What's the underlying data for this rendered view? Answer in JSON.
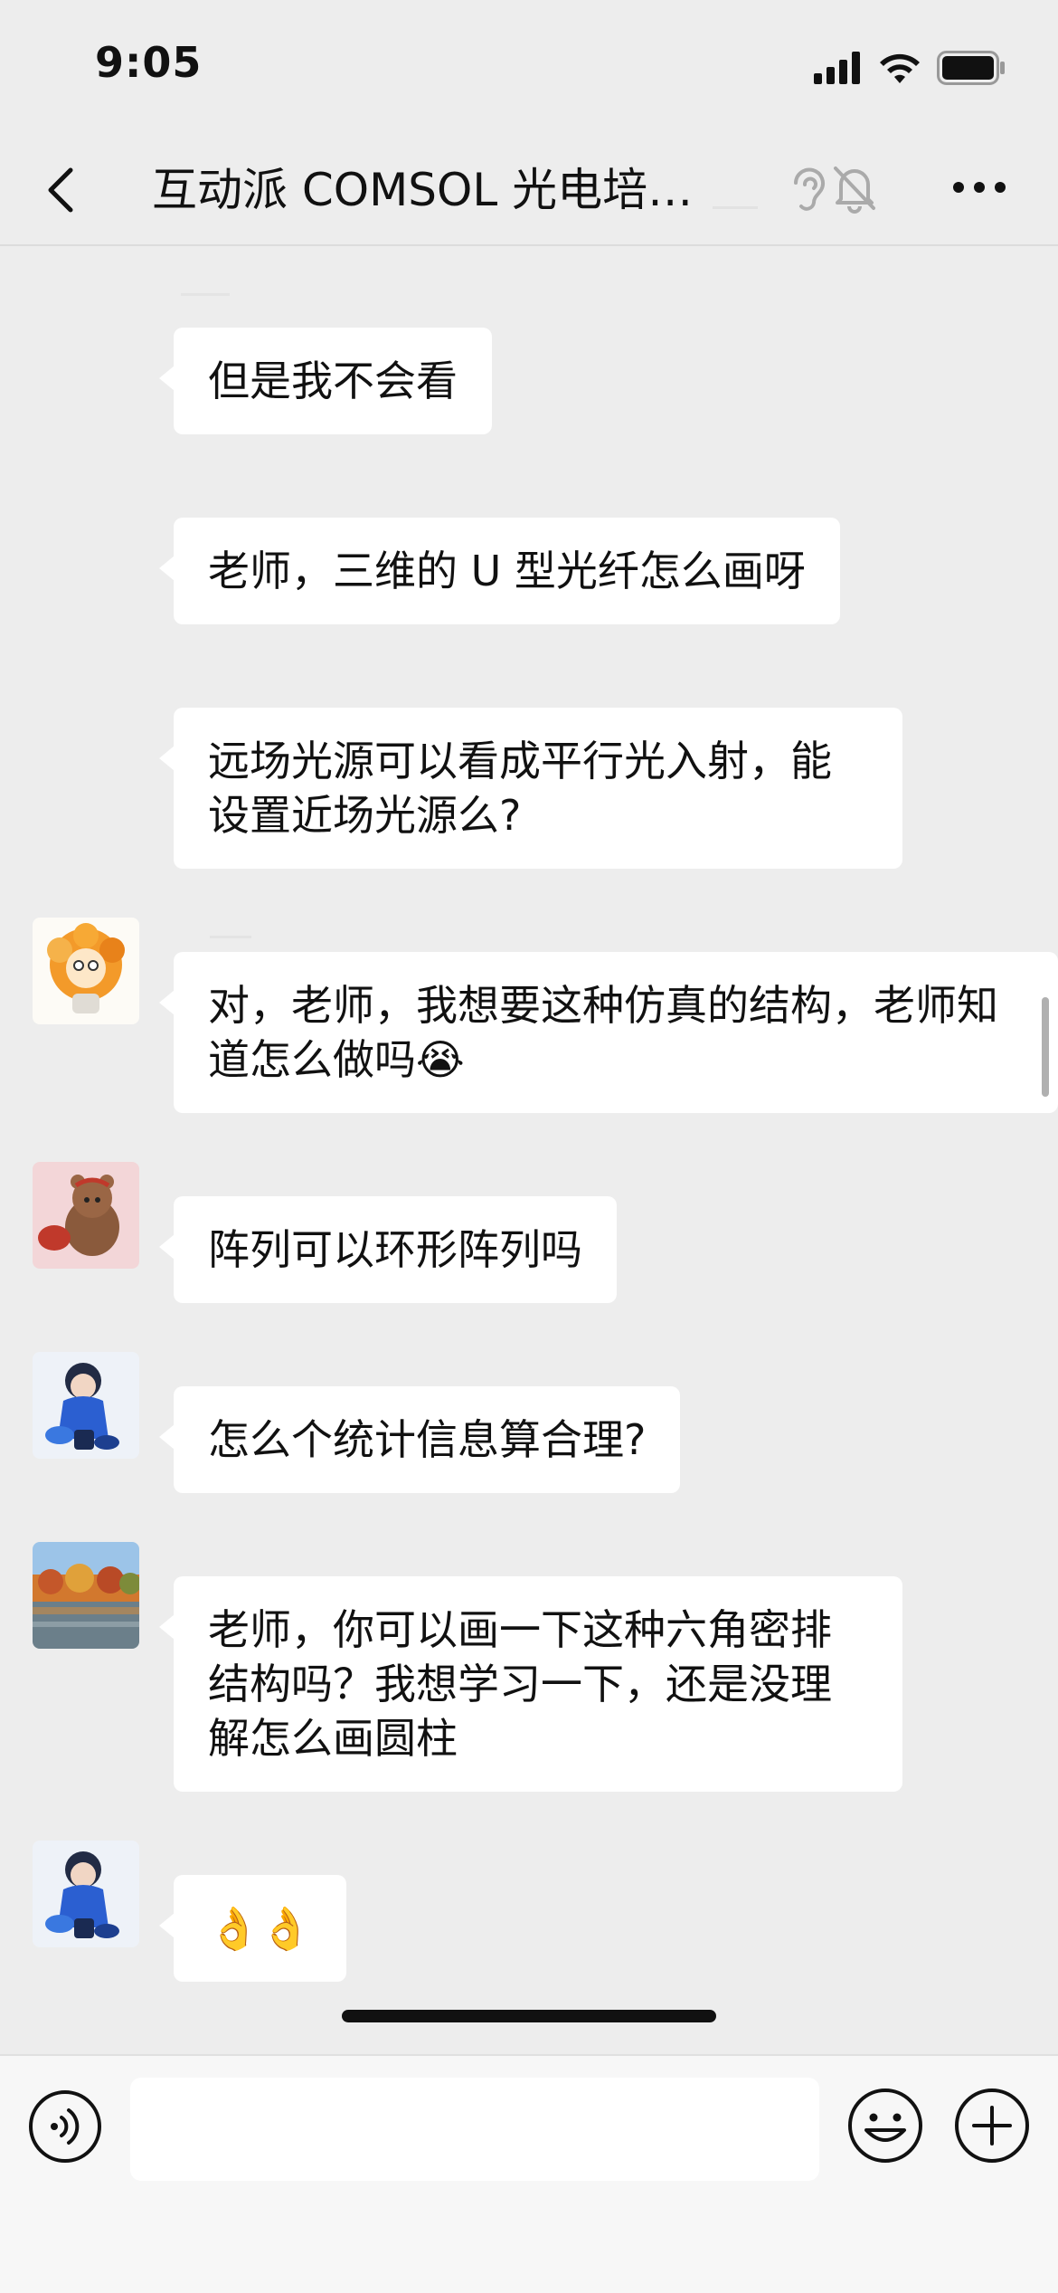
{
  "status_bar": {
    "time": "9:05"
  },
  "nav": {
    "title": "互动派 COMSOL 光电培…"
  },
  "messages": [
    {
      "text": "但是我不会看"
    },
    {
      "text": "老师，三维的 U 型光纤怎么画呀"
    },
    {
      "text": "远场光源可以看成平行光入射，能设置近场光源么?"
    },
    {
      "text": "对，老师，我想要这种仿真的结构，老师知道怎么做吗😭"
    },
    {
      "text": "阵列可以环形阵列吗"
    },
    {
      "text": "怎么个统计信息算合理?"
    },
    {
      "text": "老师，你可以画一下这种六角密排结构吗？我想学习一下，还是没理解怎么画圆柱"
    },
    {
      "text": "👌👌"
    }
  ],
  "input": {
    "value": ""
  },
  "colors": {
    "background": "#ededed",
    "bubble": "#ffffff",
    "accent": "#07c160"
  }
}
